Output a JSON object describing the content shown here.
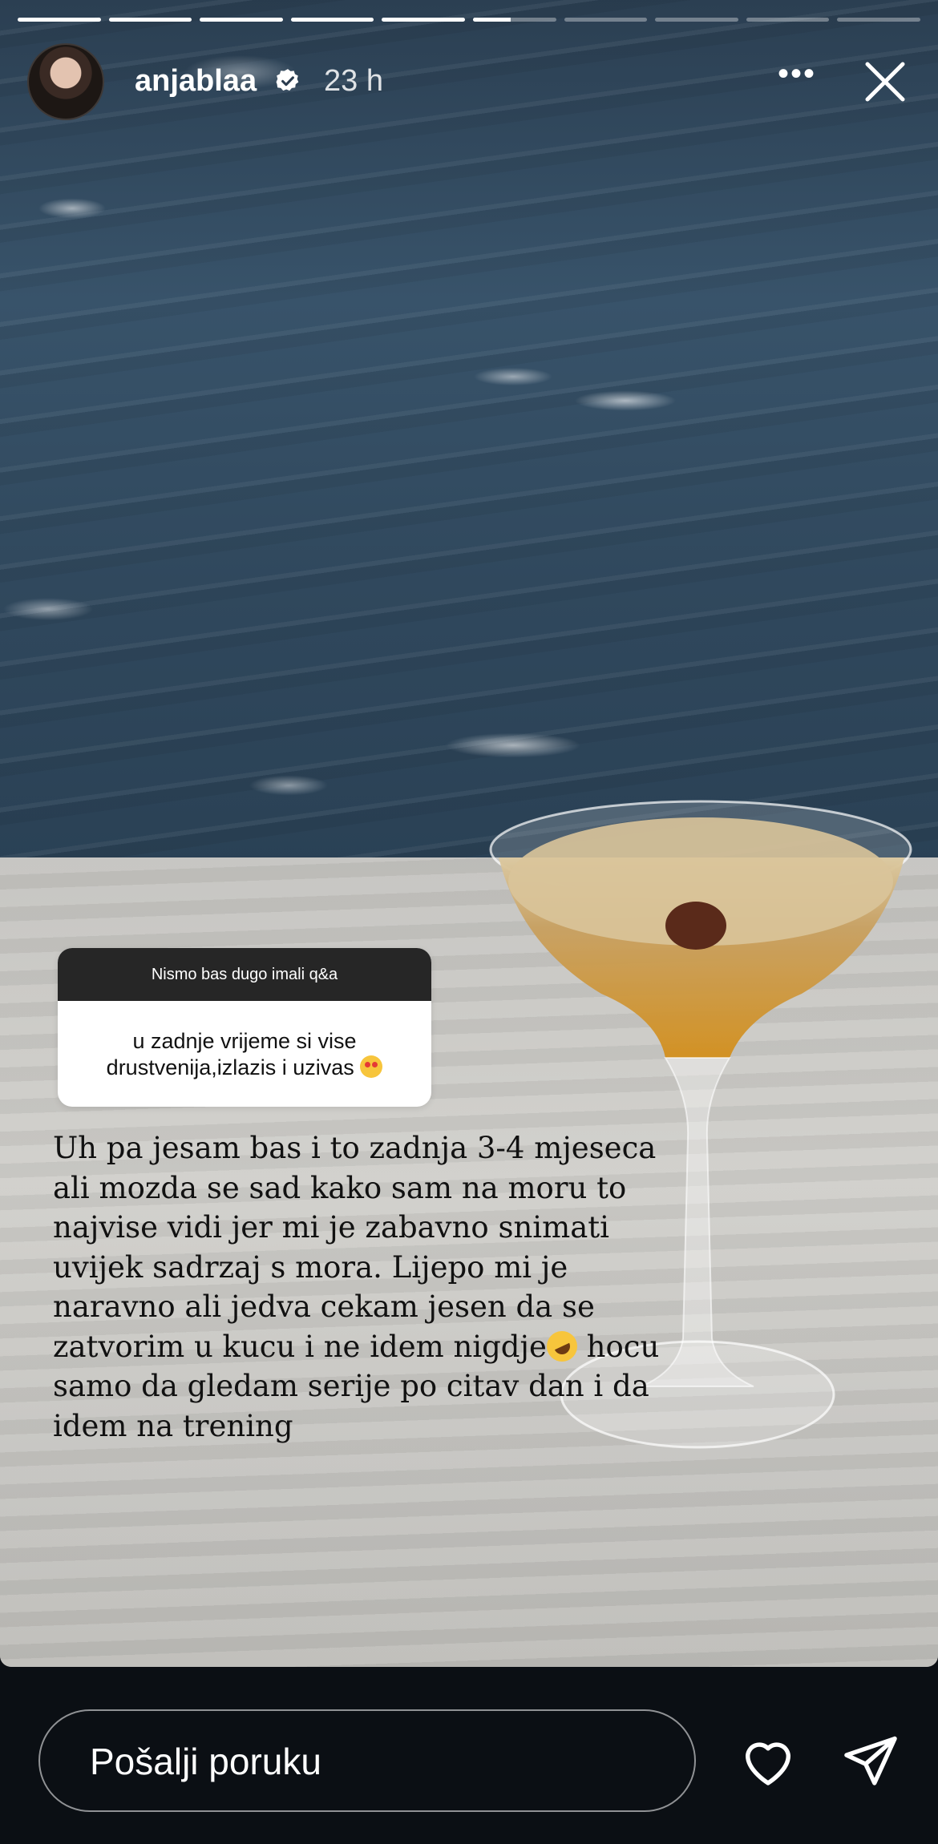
{
  "story": {
    "progress_segments": [
      1,
      1,
      1,
      1,
      1,
      0.45,
      0,
      0,
      0,
      0
    ],
    "header": {
      "username": "anjablaa",
      "time": "23 h",
      "more_label": "•••",
      "verified_icon": "verified-badge-icon",
      "close_icon": "close-icon"
    },
    "question_sticker": {
      "prompt": "Nismo bas dugo imali q&a",
      "question": "u zadnje vrijeme si vise drustvenija,izlazis i uzivas",
      "question_emoji": "heart-eyes-emoji"
    },
    "caption": {
      "text_before_emoji": "Uh pa jesam bas i to zadnja 3-4 mjeseca ali mozda se sad kako sam na moru to najvise vidi jer mi je zabavno snimati uvijek sadrzaj s mora. Lijepo mi je naravno ali jedva cekam jesen da se zatvorim u kucu i ne idem nigdje",
      "emoji": "rolling-on-floor-laughing-emoji",
      "text_after_emoji": " hocu samo da gledam serije po citav dan i da idem na trening"
    }
  },
  "bottom_bar": {
    "reply_placeholder": "Pošalji poruku",
    "like_icon": "heart-icon",
    "send_icon": "send-icon"
  },
  "colors": {
    "background": "#0b0f14",
    "sticker_header": "#262626",
    "text_white": "#ffffff"
  }
}
